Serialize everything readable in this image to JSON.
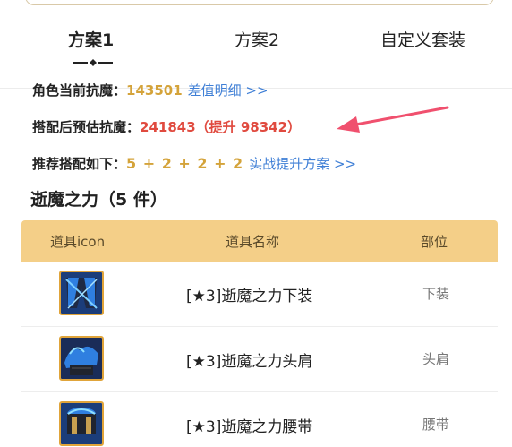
{
  "tabs": [
    {
      "label": "方案1",
      "active": true
    },
    {
      "label": "方案2",
      "active": false
    },
    {
      "label": "自定义套装",
      "active": false
    }
  ],
  "summary": {
    "current_label": "角色当前抗魔：",
    "current_value": "143501",
    "current_link": "差值明细 >>",
    "estimate_label": "搭配后预估抗魔：",
    "estimate_value": "241843",
    "estimate_increase": "（提升 98342）",
    "recommend_label": "推荐搭配如下：",
    "recommend_formula": "5 + 2 + 2 + 2",
    "recommend_link": "实战提升方案 >>"
  },
  "section": {
    "title": "逝魔之力（5 件）"
  },
  "table": {
    "headers": {
      "icon": "道具icon",
      "name": "道具名称",
      "part": "部位"
    },
    "rows": [
      {
        "name": "[★3]逝魔之力下装",
        "part": "下装",
        "icon": "pants-icon"
      },
      {
        "name": "[★3]逝魔之力头肩",
        "part": "头肩",
        "icon": "shoulder-icon"
      },
      {
        "name": "[★3]逝魔之力腰带",
        "part": "腰带",
        "icon": "belt-icon"
      }
    ]
  },
  "colors": {
    "gold": "#d4a33a",
    "red": "#e04a3f",
    "link": "#3f7fd6",
    "table_header": "#f4cf88",
    "arrow": "#f0506e"
  }
}
